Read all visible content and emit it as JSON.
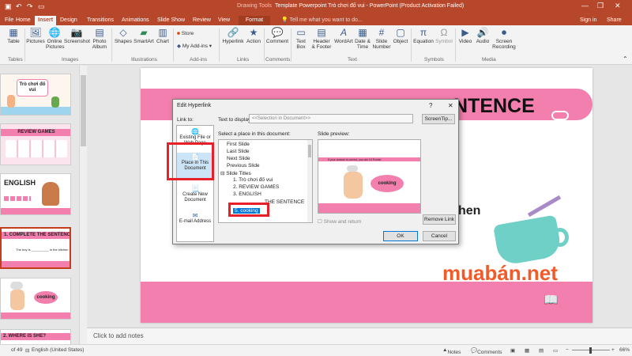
{
  "titlebar": {
    "drawing_tools": "Drawing Tools",
    "title": "Template Powerpoint Trò chơi đố vui - PowerPoint (Product Activation Failed)"
  },
  "tabs": {
    "file": "File",
    "home": "Home",
    "insert": "Insert",
    "design": "Design",
    "transitions": "Transitions",
    "animations": "Animations",
    "slideshow": "Slide Show",
    "review": "Review",
    "view": "View",
    "format": "Format",
    "tellme": "Tell me what you want to do...",
    "signin": "Sign in",
    "share": "Share"
  },
  "ribbon": {
    "table": "Table",
    "pictures": "Pictures",
    "online_pictures_1": "Online",
    "online_pictures_2": "Pictures",
    "screenshot": "Screenshot",
    "photo_album_1": "Photo",
    "photo_album_2": "Album",
    "shapes": "Shapes",
    "smartart": "SmartArt",
    "chart": "Chart",
    "store": "Store",
    "my_addins": "My Add-ins",
    "hyperlink": "Hyperlink",
    "action": "Action",
    "comment": "Comment",
    "textbox_1": "Text",
    "textbox_2": "Box",
    "header_1": "Header",
    "header_2": "& Footer",
    "wordart": "WordArt",
    "datetime_1": "Date &",
    "datetime_2": "Time",
    "slidenum_1": "Slide",
    "slidenum_2": "Number",
    "object": "Object",
    "equation": "Equation",
    "symbol": "Symbol",
    "video": "Video",
    "audio": "Audio",
    "screenrec_1": "Screen",
    "screenrec_2": "Recording",
    "groups": {
      "tables": "Tables",
      "images": "Images",
      "illustrations": "Illustrations",
      "addins": "Add-ins",
      "links": "Links",
      "comments": "Comments",
      "text": "Text",
      "symbols": "Symbols",
      "media": "Media"
    }
  },
  "thumbnails": [
    {
      "title": "Trò chơi đố vui"
    },
    {
      "title": "REVIEW GAMES"
    },
    {
      "title": "ENGLISH"
    },
    {
      "title": "1. COMPLETE THE SENTENCE",
      "sub": "The boy is __________ in the kitchen"
    },
    {
      "bubble": "cooking"
    },
    {
      "title": "2. WHERE IS SHE?"
    }
  ],
  "slide": {
    "title_fragment": "NTENCE",
    "text_fragment": "hen",
    "watermark": "muabán.net"
  },
  "notes": {
    "placeholder": "Click to add notes"
  },
  "status": {
    "slide_of": "of 49",
    "language": "English (United States)",
    "notes": "Notes",
    "comments": "Comments",
    "zoom": "66%"
  },
  "dialog": {
    "title": "Edit Hyperlink",
    "help": "?",
    "close": "✕",
    "link_to": "Link to:",
    "text_to_display_label": "Text to display:",
    "text_to_display_value": "<<Selection in Document>>",
    "screentip": "ScreenTip...",
    "select_place": "Select a place in this document:",
    "slide_preview": "Slide preview:",
    "link_existing_1": "Existing File or",
    "link_existing_2": "Web Page",
    "link_place_1": "Place in This",
    "link_place_2": "Document",
    "link_create_1": "Create New",
    "link_create_2": "Document",
    "link_email": "E-mail Address",
    "tree": [
      "First Slide",
      "Last Slide",
      "Next Slide",
      "Previous Slide",
      "Slide Titles",
      "1. Trò chơi đố vui",
      "2. REVIEW GAMES",
      "3. ENGLISH",
      "THE SENTENCE",
      "5. cooking"
    ],
    "preview_caption": "If your answer is correct, you win 10 Points!",
    "preview_bubble": "cooking",
    "show_return": "Show and return",
    "remove_link": "Remove Link",
    "ok": "OK",
    "cancel": "Cancel"
  },
  "colors": {
    "accent": "#b7472a",
    "pink": "#f27fae",
    "highlight_red": "#e8202a",
    "select_blue": "#0078d7"
  }
}
